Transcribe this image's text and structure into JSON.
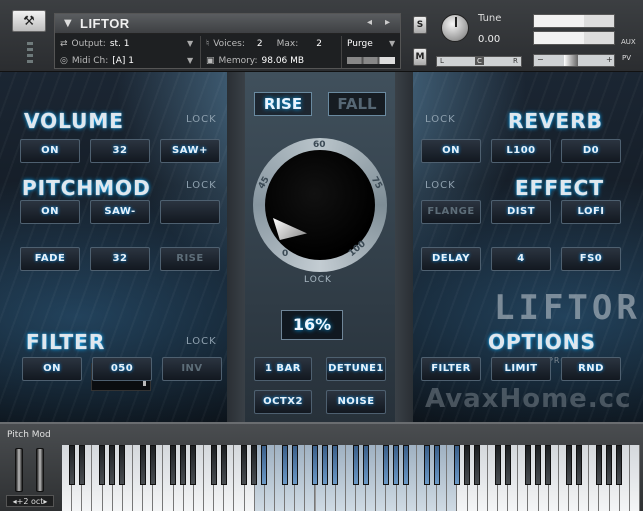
{
  "header": {
    "instrument_name": "LIFTOR",
    "output_label": "Output:",
    "output_value": "st. 1",
    "voices_label": "Voices:",
    "voices_value": "2",
    "max_label": "Max:",
    "max_value": "2",
    "purge_label": "Purge",
    "midi_label": "Midi Ch:",
    "midi_value": "[A]  1",
    "memory_label": "Memory:",
    "memory_value": "98.06 MB",
    "s_label": "S",
    "m_label": "M",
    "tune_label": "Tune",
    "tune_value": "0.00",
    "pan_left": "L",
    "pan_center": "C",
    "pan_right": "R",
    "aux_label": "AUX",
    "pv_label": "PV",
    "vol_minus": "−",
    "vol_plus": "+"
  },
  "volume": {
    "title": "VOLUME",
    "lock": "LOCK",
    "buttons": [
      "ON",
      "32",
      "SAW+"
    ]
  },
  "pitchmod": {
    "title": "PITCHMOD",
    "lock": "LOCK",
    "buttons": [
      "ON",
      "SAW-",
      ""
    ],
    "fade": "FADE",
    "fade_value": "32",
    "rise": "RISE"
  },
  "filter": {
    "title": "FILTER",
    "lock": "LOCK",
    "buttons": [
      "ON",
      "050",
      "INV"
    ]
  },
  "reverb": {
    "title": "REVERB",
    "lock": "LOCK",
    "buttons": [
      "ON",
      "L100",
      "D0"
    ]
  },
  "effect": {
    "title": "EFFECT",
    "lock": "LOCK",
    "buttons": [
      "FLANGE",
      "DIST",
      "LOFI"
    ],
    "delay": "DELAY",
    "delay_value": "4",
    "fs": "FS0"
  },
  "options": {
    "title": "OPTIONS",
    "buttons": [
      "FILTER",
      "LIMIT",
      "RND"
    ]
  },
  "center": {
    "rise": "RISE",
    "fall": "FALL",
    "ticks": [
      "60",
      "45",
      "75",
      "0",
      "100"
    ],
    "dial_lock": "LOCK",
    "percent": "16%",
    "bar": "1 BAR",
    "detune": "DETUNE1",
    "oct": "OCTX2",
    "noise": "NOISE"
  },
  "logo": {
    "sub": "PROGYON",
    "name": "LIFTOR"
  },
  "watermark": "AvaxHome.cc",
  "keyboard": {
    "pitch_mod_label": "Pitch Mod",
    "octave_label": "◂+2 oct▸"
  }
}
